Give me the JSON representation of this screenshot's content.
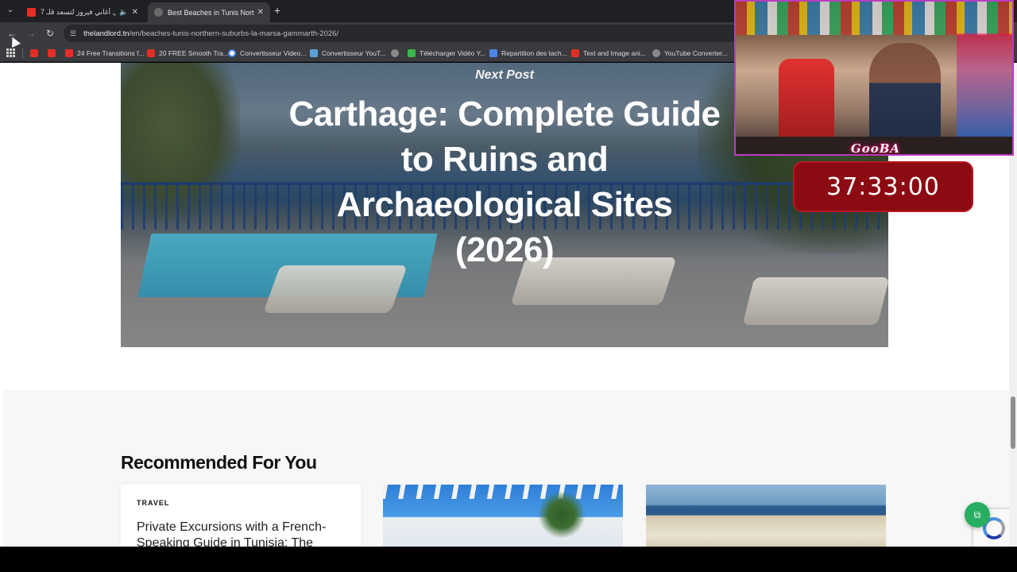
{
  "browser": {
    "tabs": [
      {
        "title": "7 أجمل أغاني فيروز لتسعد قلـ",
        "active": false,
        "icon": "youtube-icon",
        "audio": true
      },
      {
        "title": "Best Beaches in Tunis Northern",
        "active": true,
        "icon": "site-icon"
      }
    ],
    "new_tab": "+",
    "url_host": "thelandlord.tn",
    "url_path": "/en/beaches-tunis-northern-suburbs-la-marsa-gammarth-2026/",
    "bookmarks": [
      {
        "label": "",
        "icon": "youtube-icon"
      },
      {
        "label": "",
        "icon": "youtube-icon"
      },
      {
        "label": "24 Free Transitions f...",
        "icon": "youtube-icon"
      },
      {
        "label": "20 FREE Smooth Tra...",
        "icon": "youtube-icon"
      },
      {
        "label": "Convertisseur Video...",
        "icon": "google-icon"
      },
      {
        "label": "Convertisseur YouT...",
        "icon": "converter-icon"
      },
      {
        "label": "",
        "icon": "globe-icon"
      },
      {
        "label": "Télécharger Vidéo Y...",
        "icon": "download-icon"
      },
      {
        "label": "Repartition des tach...",
        "icon": "docs-icon"
      },
      {
        "label": "Text and Image ani...",
        "icon": "youtube-icon"
      },
      {
        "label": "YouTube Converter...",
        "icon": "globe-icon"
      }
    ]
  },
  "hero": {
    "label": "Next Post",
    "title": "Carthage: Complete Guide to Ruins and Archaeological Sites (2026)"
  },
  "recommended": {
    "heading": "Recommended For You",
    "cards": [
      {
        "category": "TRAVEL",
        "title": "Private Excursions with a French-Speaking Guide in Tunisia: The"
      }
    ]
  },
  "overlay": {
    "logo": "GooBA",
    "timer": "37:33:00"
  },
  "colors": {
    "share_button": "#27ae60",
    "timer_bg": "#8c0a12",
    "browser_chrome": "#3a3b3e"
  }
}
